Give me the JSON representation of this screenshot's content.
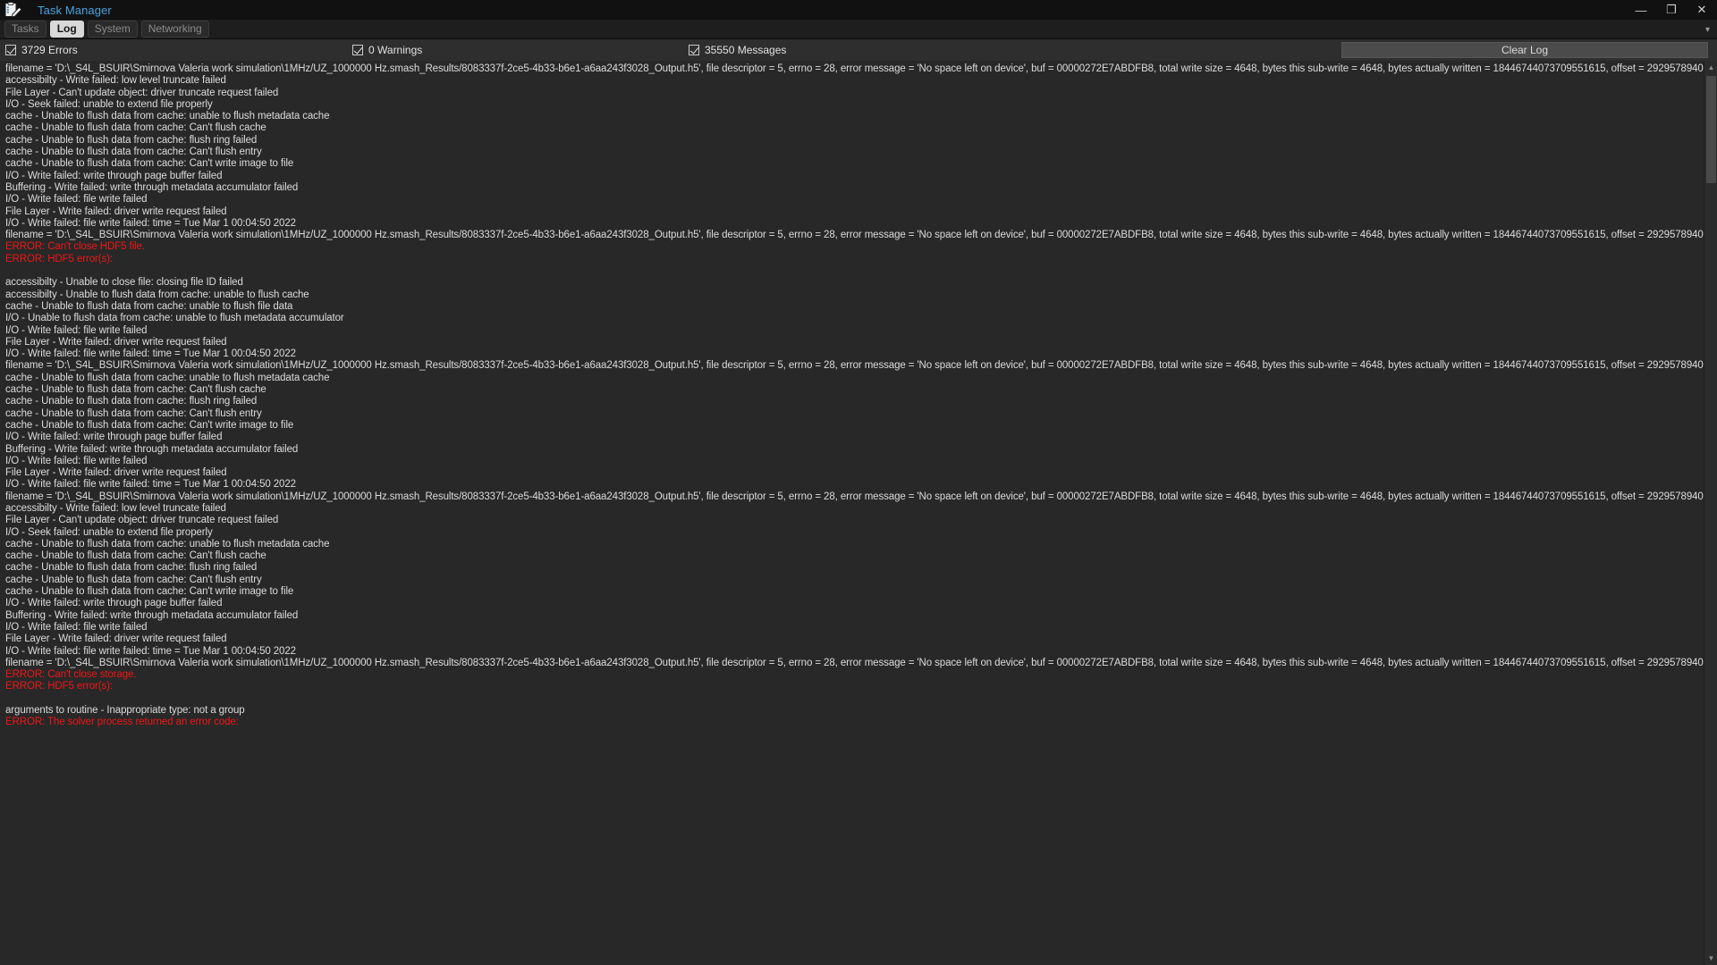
{
  "window": {
    "title": "Task Manager",
    "icon": "clipboard-pencil-icon",
    "minimize_label": "—",
    "maximize_label": "❐",
    "close_label": "✕"
  },
  "tabs": [
    {
      "label": "Tasks",
      "active": false
    },
    {
      "label": "Log",
      "active": true
    },
    {
      "label": "System",
      "active": false
    },
    {
      "label": "Networking",
      "active": false
    }
  ],
  "tabstrip": {
    "overflow_caret": "▾"
  },
  "filters": {
    "errors": {
      "label": "3729 Errors",
      "checked": true,
      "count": 3729
    },
    "warnings": {
      "label": "0 Warnings",
      "checked": true,
      "count": 0
    },
    "messages": {
      "label": "35550 Messages",
      "checked": true,
      "count": 35550
    }
  },
  "toolbar": {
    "clear_log_label": "Clear Log"
  },
  "colors": {
    "accent_title": "#4aa3df",
    "error_text": "#f01616",
    "normal_text": "#dcdcdc",
    "log_background": "#282828",
    "filter_background": "#2e2e2e"
  },
  "scrollbar": {
    "up_arrow": "▲",
    "down_arrow": "▼"
  },
  "log": {
    "lines": [
      {
        "t": "filename = 'D:\\_S4L_BSUIR\\Smirnova Valeria  work simulation\\1MHz/UZ_1000000 Hz.smash_Results/8083337f-2ce5-4b33-b6e1-a6aa243f3028_Output.h5', file descriptor = 5, errno = 28, error message = 'No space left on device', buf = 00000272E7ABDFB8, total write size = 4648, bytes this sub-write = 4648, bytes actually written = 18446744073709551615, offset = 2929578940",
        "e": false
      },
      {
        "t": "accessibilty - Write failed: low level truncate failed",
        "e": false
      },
      {
        "t": "File Layer - Can't update object: driver truncate request failed",
        "e": false
      },
      {
        "t": "I/O - Seek failed: unable to extend file properly",
        "e": false
      },
      {
        "t": "cache - Unable to flush data from cache: unable to flush metadata cache",
        "e": false
      },
      {
        "t": "cache - Unable to flush data from cache: Can't flush cache",
        "e": false
      },
      {
        "t": "cache - Unable to flush data from cache: flush ring failed",
        "e": false
      },
      {
        "t": "cache - Unable to flush data from cache: Can't flush entry",
        "e": false
      },
      {
        "t": "cache - Unable to flush data from cache: Can't write image to file",
        "e": false
      },
      {
        "t": "I/O - Write failed: write through page buffer failed",
        "e": false
      },
      {
        "t": "Buffering - Write failed: write through metadata accumulator failed",
        "e": false
      },
      {
        "t": "I/O - Write failed: file write failed",
        "e": false
      },
      {
        "t": "File Layer - Write failed: driver write request failed",
        "e": false
      },
      {
        "t": "I/O - Write failed: file write failed: time = Tue Mar  1 00:04:50 2022",
        "e": false
      },
      {
        "t": "filename = 'D:\\_S4L_BSUIR\\Smirnova Valeria  work simulation\\1MHz/UZ_1000000 Hz.smash_Results/8083337f-2ce5-4b33-b6e1-a6aa243f3028_Output.h5', file descriptor = 5, errno = 28, error message = 'No space left on device', buf = 00000272E7ABDFB8, total write size = 4648, bytes this sub-write = 4648, bytes actually written = 18446744073709551615, offset = 2929578940",
        "e": false
      },
      {
        "t": "ERROR: Can't close HDF5 file.",
        "e": true
      },
      {
        "t": "ERROR: HDF5 error(s):",
        "e": true
      },
      {
        "t": "",
        "e": false
      },
      {
        "t": "accessibilty - Unable to close file: closing file ID failed",
        "e": false
      },
      {
        "t": "accessibilty - Unable to flush data from cache: unable to flush cache",
        "e": false
      },
      {
        "t": "cache - Unable to flush data from cache: unable to flush file data",
        "e": false
      },
      {
        "t": "I/O - Unable to flush data from cache: unable to flush metadata accumulator",
        "e": false
      },
      {
        "t": "I/O - Write failed: file write failed",
        "e": false
      },
      {
        "t": "File Layer - Write failed: driver write request failed",
        "e": false
      },
      {
        "t": "I/O - Write failed: file write failed: time = Tue Mar  1 00:04:50 2022",
        "e": false
      },
      {
        "t": "filename = 'D:\\_S4L_BSUIR\\Smirnova Valeria  work simulation\\1MHz/UZ_1000000 Hz.smash_Results/8083337f-2ce5-4b33-b6e1-a6aa243f3028_Output.h5', file descriptor = 5, errno = 28, error message = 'No space left on device', buf = 00000272E7ABDFB8, total write size = 4648, bytes this sub-write = 4648, bytes actually written = 18446744073709551615, offset = 2929578940",
        "e": false
      },
      {
        "t": "cache - Unable to flush data from cache: unable to flush metadata cache",
        "e": false
      },
      {
        "t": "cache - Unable to flush data from cache: Can't flush cache",
        "e": false
      },
      {
        "t": "cache - Unable to flush data from cache: flush ring failed",
        "e": false
      },
      {
        "t": "cache - Unable to flush data from cache: Can't flush entry",
        "e": false
      },
      {
        "t": "cache - Unable to flush data from cache: Can't write image to file",
        "e": false
      },
      {
        "t": "I/O - Write failed: write through page buffer failed",
        "e": false
      },
      {
        "t": "Buffering - Write failed: write through metadata accumulator failed",
        "e": false
      },
      {
        "t": "I/O - Write failed: file write failed",
        "e": false
      },
      {
        "t": "File Layer - Write failed: driver write request failed",
        "e": false
      },
      {
        "t": "I/O - Write failed: file write failed: time = Tue Mar  1 00:04:50 2022",
        "e": false
      },
      {
        "t": "filename = 'D:\\_S4L_BSUIR\\Smirnova Valeria  work simulation\\1MHz/UZ_1000000 Hz.smash_Results/8083337f-2ce5-4b33-b6e1-a6aa243f3028_Output.h5', file descriptor = 5, errno = 28, error message = 'No space left on device', buf = 00000272E7ABDFB8, total write size = 4648, bytes this sub-write = 4648, bytes actually written = 18446744073709551615, offset = 2929578940",
        "e": false
      },
      {
        "t": "accessibilty - Write failed: low level truncate failed",
        "e": false
      },
      {
        "t": "File Layer - Can't update object: driver truncate request failed",
        "e": false
      },
      {
        "t": "I/O - Seek failed: unable to extend file properly",
        "e": false
      },
      {
        "t": "cache - Unable to flush data from cache: unable to flush metadata cache",
        "e": false
      },
      {
        "t": "cache - Unable to flush data from cache: Can't flush cache",
        "e": false
      },
      {
        "t": "cache - Unable to flush data from cache: flush ring failed",
        "e": false
      },
      {
        "t": "cache - Unable to flush data from cache: Can't flush entry",
        "e": false
      },
      {
        "t": "cache - Unable to flush data from cache: Can't write image to file",
        "e": false
      },
      {
        "t": "I/O - Write failed: write through page buffer failed",
        "e": false
      },
      {
        "t": "Buffering - Write failed: write through metadata accumulator failed",
        "e": false
      },
      {
        "t": "I/O - Write failed: file write failed",
        "e": false
      },
      {
        "t": "File Layer - Write failed: driver write request failed",
        "e": false
      },
      {
        "t": "I/O - Write failed: file write failed: time = Tue Mar  1 00:04:50 2022",
        "e": false
      },
      {
        "t": "filename = 'D:\\_S4L_BSUIR\\Smirnova Valeria  work simulation\\1MHz/UZ_1000000 Hz.smash_Results/8083337f-2ce5-4b33-b6e1-a6aa243f3028_Output.h5', file descriptor = 5, errno = 28, error message = 'No space left on device', buf = 00000272E7ABDFB8, total write size = 4648, bytes this sub-write = 4648, bytes actually written = 18446744073709551615, offset = 2929578940",
        "e": false
      },
      {
        "t": "ERROR: Can't close storage.",
        "e": true
      },
      {
        "t": "ERROR: HDF5 error(s):",
        "e": true
      },
      {
        "t": "",
        "e": false
      },
      {
        "t": "arguments to routine - Inappropriate type: not a group",
        "e": false
      },
      {
        "t": "ERROR: The solver process returned an error code:",
        "e": true
      }
    ]
  }
}
